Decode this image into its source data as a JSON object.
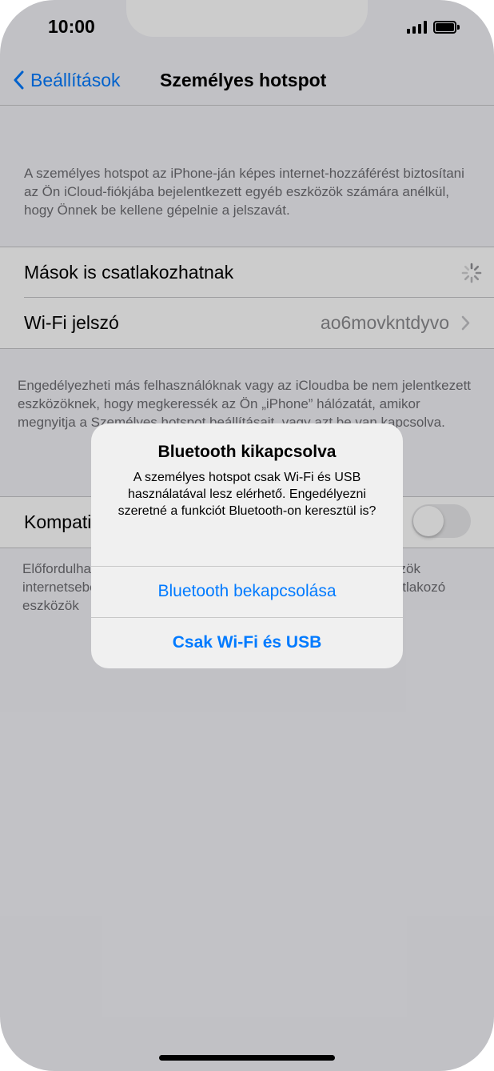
{
  "status_bar": {
    "time": "10:00"
  },
  "nav": {
    "back_label": "Beállítások",
    "title": "Személyes hotspot"
  },
  "intro_text": "A személyes hotspot az iPhone-ján képes internet-hozzáférést biztosítani az Ön iCloud-fiókjába bejelentkezett egyéb eszközök számára anélkül, hogy Önnek be kellene gépelnie a jelszavát.",
  "settings": {
    "allow_others_label": "Mások is csatlakozhatnak",
    "wifi_password_label": "Wi-Fi jelszó",
    "wifi_password_value": "ao6movkntdyvo"
  },
  "allow_text": "Engedélyezheti más felhasználóknak vagy az iCloudba be nem jelentkezett eszközöknek, hogy megkeressék az Ön „iPhone” hálózatát, amikor megnyitja a Személyes hotspot beállításait, vagy azt be van kapcsolva.",
  "compat": {
    "label": "Kompatibilitás maximalizálása",
    "enabled": false
  },
  "compat_text": "Előfordulhat, hogy ez csökkenti a hotspothoz csatlakozó eszközök internetsebességét, ha az eszközök számára szükséges, a csatlakozó eszközök",
  "alert": {
    "title": "Bluetooth kikapcsolva",
    "message": "A személyes hotspot csak Wi-Fi és USB használatával lesz elérhető. Engedélyezni szeretné a funkciót Bluetooth-on keresztül is?",
    "button_1": "Bluetooth bekapcsolása",
    "button_2": "Csak Wi-Fi és USB"
  },
  "colors": {
    "accent": "#007aff",
    "background": "#f2f2f7"
  },
  "icons": [
    "chevron-left-icon",
    "chevron-right-icon",
    "spinner-icon",
    "signal-icon",
    "battery-icon"
  ]
}
